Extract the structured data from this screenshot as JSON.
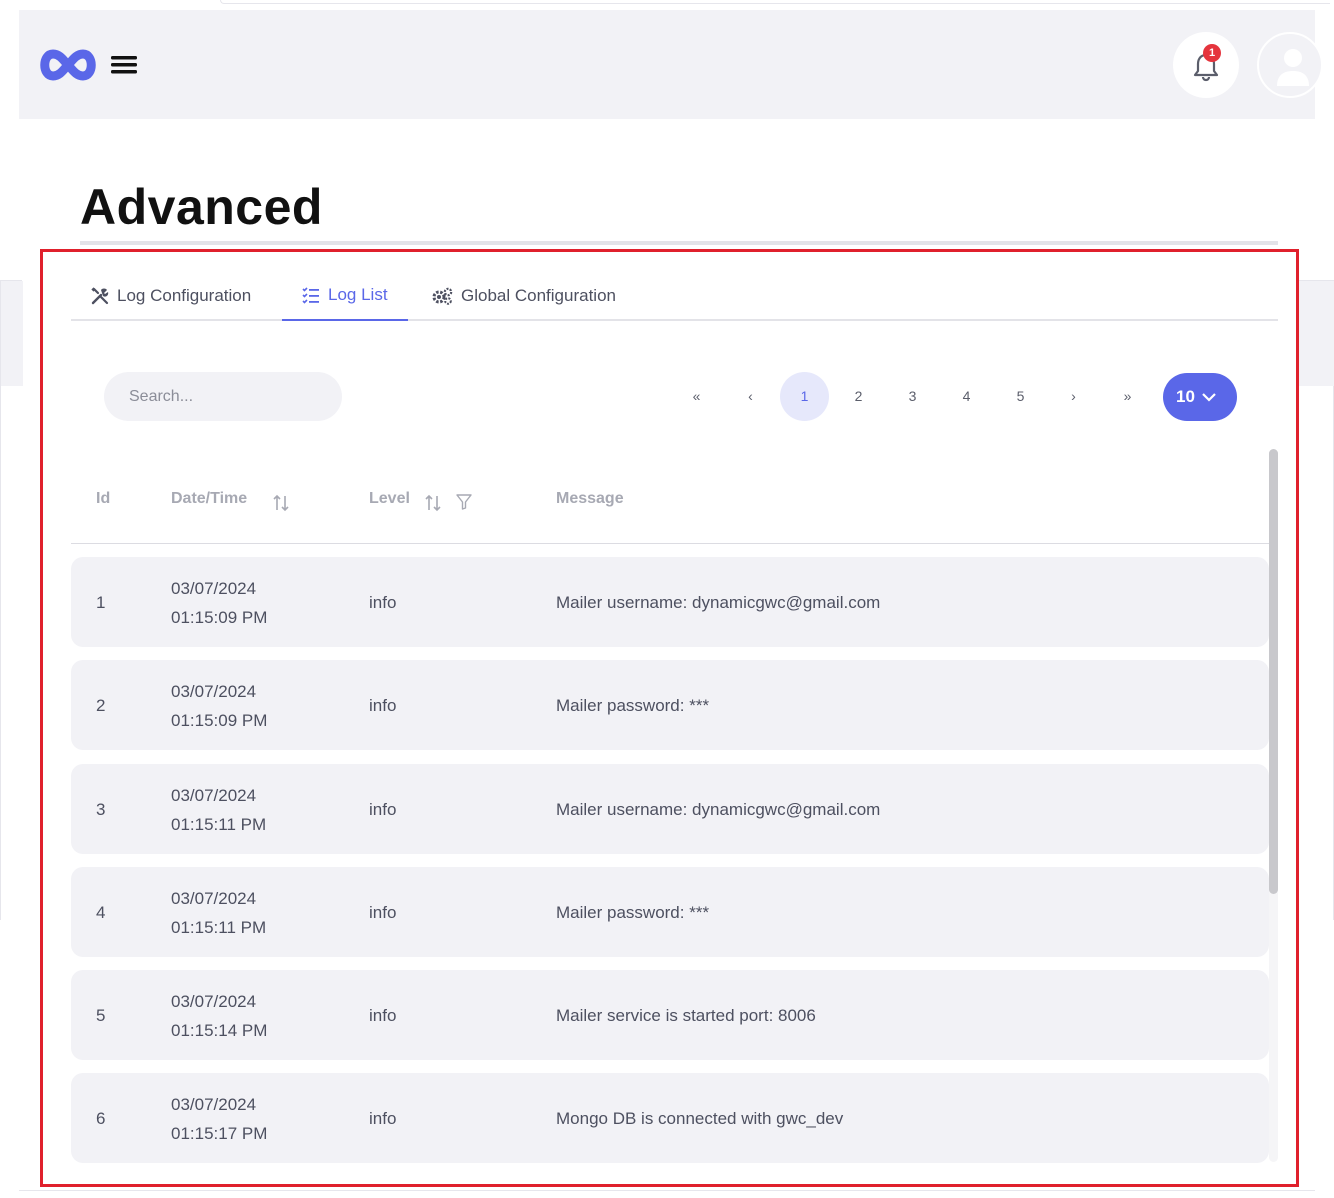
{
  "header": {
    "notification_count": "1"
  },
  "page": {
    "title": "Advanced"
  },
  "tabs": [
    {
      "label": "Log Configuration",
      "icon": "tools-icon",
      "active": false
    },
    {
      "label": "Log List",
      "icon": "list-check-icon",
      "active": true
    },
    {
      "label": "Global Configuration",
      "icon": "gears-icon",
      "active": false
    }
  ],
  "search": {
    "placeholder": "Search..."
  },
  "pagination": {
    "first": "«",
    "prev": "‹",
    "pages": [
      "1",
      "2",
      "3",
      "4",
      "5"
    ],
    "current_page": "1",
    "next": "›",
    "last": "»",
    "per_page": "10"
  },
  "table": {
    "columns": {
      "id": "Id",
      "datetime": "Date/Time",
      "level": "Level",
      "message": "Message"
    },
    "rows": [
      {
        "id": "1",
        "date": "03/07/2024",
        "time": "01:15:09 PM",
        "level": "info",
        "message": "Mailer username: dynamicgwc@gmail.com"
      },
      {
        "id": "2",
        "date": "03/07/2024",
        "time": "01:15:09 PM",
        "level": "info",
        "message": "Mailer password: ***"
      },
      {
        "id": "3",
        "date": "03/07/2024",
        "time": "01:15:11 PM",
        "level": "info",
        "message": "Mailer username: dynamicgwc@gmail.com"
      },
      {
        "id": "4",
        "date": "03/07/2024",
        "time": "01:15:11 PM",
        "level": "info",
        "message": "Mailer password: ***"
      },
      {
        "id": "5",
        "date": "03/07/2024",
        "time": "01:15:14 PM",
        "level": "info",
        "message": "Mailer service is started port: 8006"
      },
      {
        "id": "6",
        "date": "03/07/2024",
        "time": "01:15:17 PM",
        "level": "info",
        "message": "Mongo DB is connected with gwc_dev"
      }
    ]
  },
  "colors": {
    "accent": "#5a67e8",
    "badge": "#e5343d",
    "highlight_frame": "#e0202c",
    "row_bg": "#f2f2f6"
  }
}
